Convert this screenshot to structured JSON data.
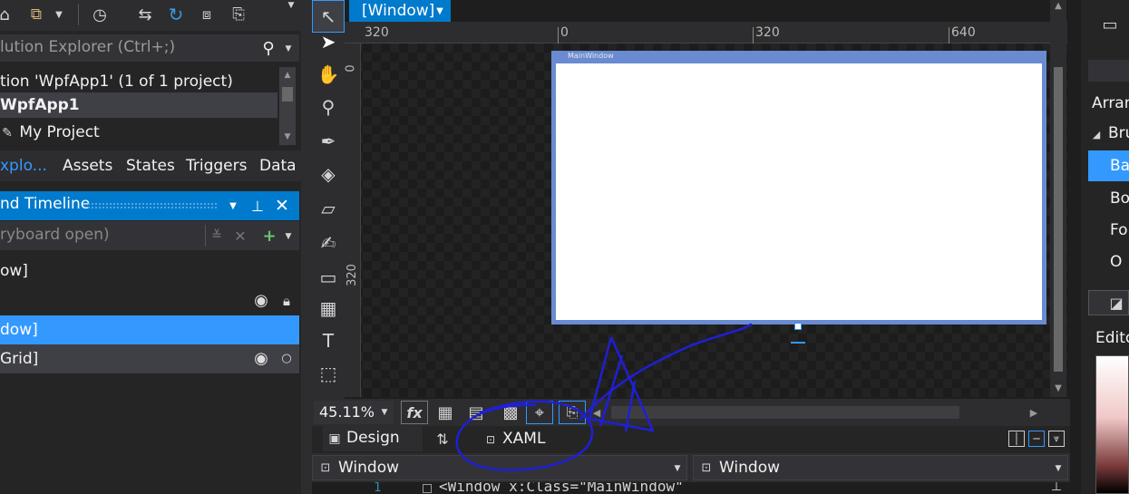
{
  "solution_explorer": {
    "search_placeholder": "lution Explorer (Ctrl+;)",
    "solution_label": "tion 'WpfApp1' (1 of 1 project)",
    "project_label": "WpfApp1",
    "my_project_label": "My Project"
  },
  "panel_tabs": [
    "xplo...",
    "Assets",
    "States",
    "Triggers",
    "Data"
  ],
  "timeline": {
    "title": "nd Timeline",
    "storyboard_placeholder": "ryboard open)",
    "rows": [
      "ow]",
      "dow]",
      "Grid]"
    ]
  },
  "ruler": {
    "h_ticks": [
      "320",
      "0",
      "320",
      "640"
    ],
    "v_ticks": [
      "0",
      "320"
    ]
  },
  "breadcrumb": "[Window]",
  "window_caption": "MainWindow",
  "zoom": "45.11%",
  "doc_tabs": {
    "design": "Design",
    "xaml": "XAML"
  },
  "nav": {
    "left_scope": "Window",
    "right_scope": "Window"
  },
  "code": {
    "line_number": "1",
    "line_text": "<Window x:Class=\"MainWindow\""
  },
  "properties": {
    "arrange_label": "Arran",
    "brush_section": "Bru",
    "brush_rows": [
      "Ba",
      "Bo",
      "Fo",
      "O"
    ],
    "editor_label": "Edito"
  },
  "colors": {
    "accent": "#007acc",
    "selection": "#3399ff",
    "annotation_ink": "#1f1fd6"
  }
}
